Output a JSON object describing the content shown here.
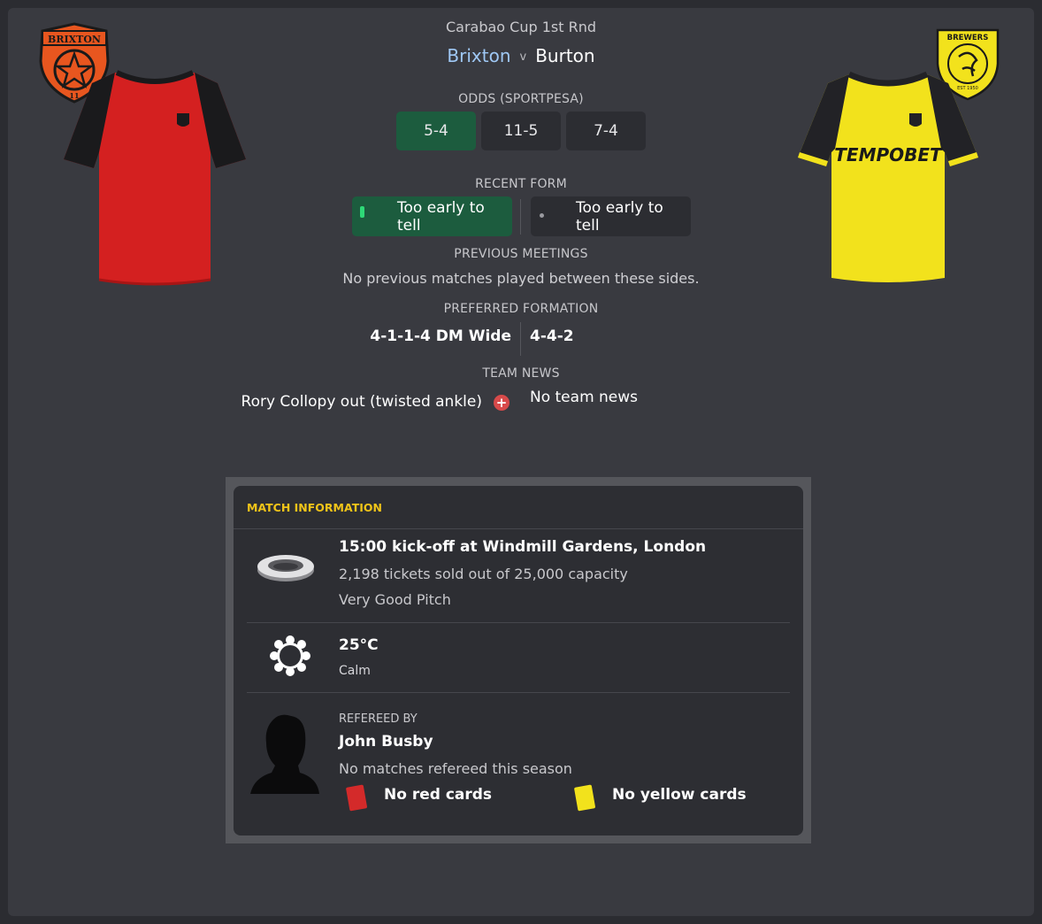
{
  "competition": "Carabao Cup 1st Rnd",
  "teams": {
    "home": "Brixton",
    "vs": "v",
    "away": "Burton"
  },
  "home_crest": {
    "top_text": "BRIXTON",
    "bottom_text": "11",
    "color": "#e8561f"
  },
  "away_crest": {
    "top_text": "BREWERS",
    "bottom_text": "EST 1950",
    "color": "#f2e21c"
  },
  "away_kit": {
    "sponsor": "TEMPOBET"
  },
  "odds": {
    "heading": "ODDS (SPORTPESA)",
    "values": [
      "5-4",
      "11-5",
      "7-4"
    ]
  },
  "form": {
    "heading": "RECENT FORM",
    "home": "Too early to tell",
    "away": "Too early to tell"
  },
  "previous": {
    "heading": "PREVIOUS MEETINGS",
    "text": "No previous matches played between these sides."
  },
  "formation": {
    "heading": "PREFERRED FORMATION",
    "home": "4-1-1-4 DM Wide",
    "away": "4-4-2"
  },
  "news": {
    "heading": "TEAM NEWS",
    "home": "Rory Collopy out (twisted ankle)",
    "away": "No team news"
  },
  "match_info": {
    "title": "MATCH INFORMATION",
    "venue": {
      "kickoff": "15:00 kick-off at Windmill Gardens, London",
      "tickets": "2,198 tickets sold out of 25,000 capacity",
      "pitch": "Very Good Pitch"
    },
    "weather": {
      "temp": "25°C",
      "condition": "Calm"
    },
    "referee": {
      "label": "REFEREED BY",
      "name": "John Busby",
      "matches": "No matches refereed this season",
      "red": "No red cards",
      "yellow": "No yellow cards"
    }
  },
  "colors": {
    "background": "#393a40",
    "favourite_green": "#1c5c3e",
    "accent_yellow": "#f0c419",
    "home_team_blue": "#9fc8f5",
    "red_card": "#d42a2a",
    "yellow_card": "#f2e21c"
  }
}
